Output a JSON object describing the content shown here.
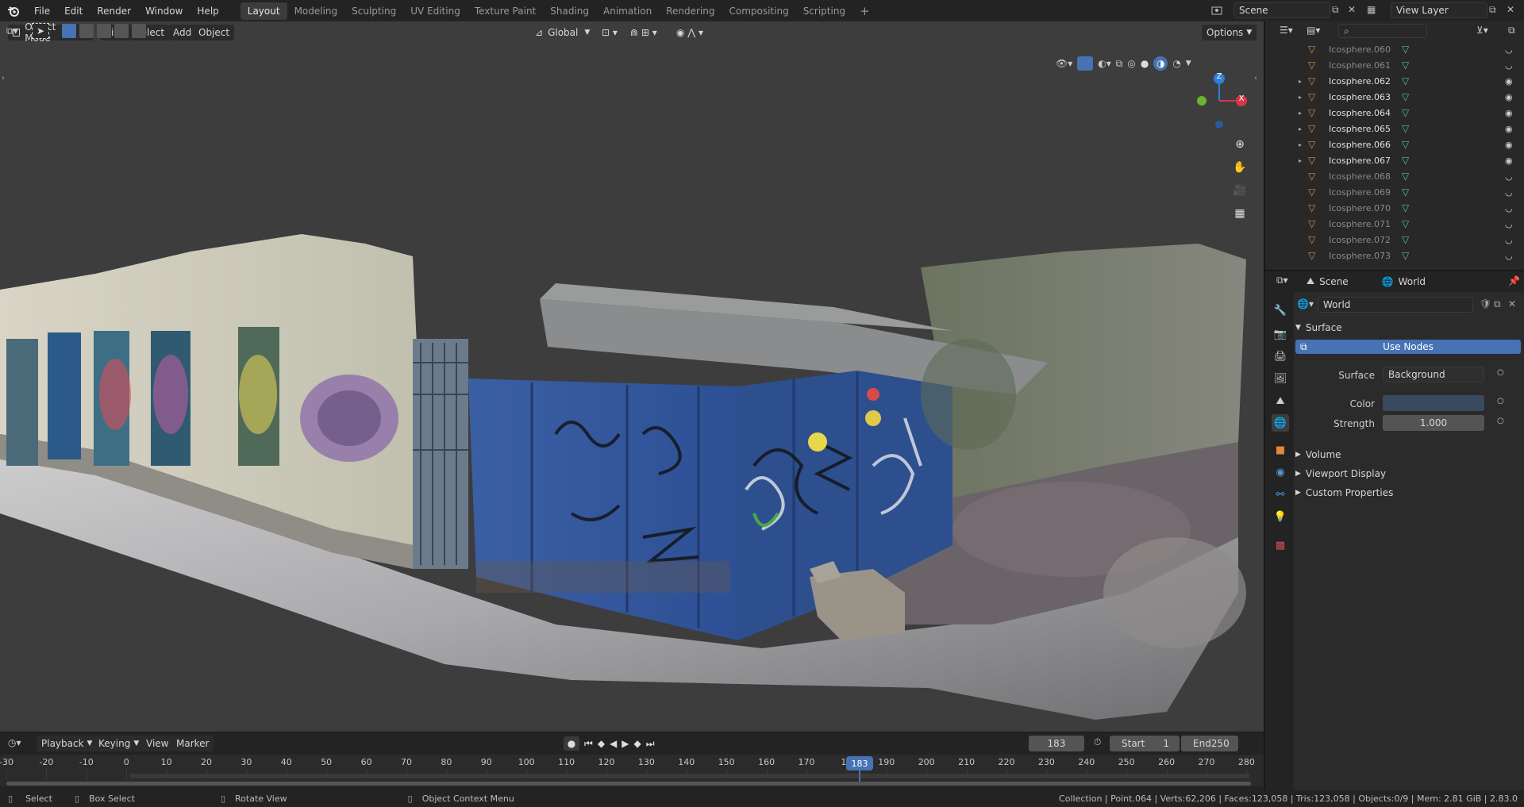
{
  "menus": [
    "File",
    "Edit",
    "Render",
    "Window",
    "Help"
  ],
  "workspaces": [
    "Layout",
    "Modeling",
    "Sculpting",
    "UV Editing",
    "Texture Paint",
    "Shading",
    "Animation",
    "Rendering",
    "Compositing",
    "Scripting"
  ],
  "active_workspace": "Layout",
  "add_workspace_icon": "+",
  "scene_name": "Scene",
  "view_layer_name": "View Layer",
  "viewport": {
    "mode": "Object Mode",
    "header_menus": [
      "View",
      "Select",
      "Add",
      "Object"
    ],
    "transform_orientation": "Global",
    "options_label": "Options",
    "gizmo": {
      "z_label": "Z",
      "x_label": "X",
      "y_label": "Y"
    },
    "nav_icons": [
      "zoom-icon",
      "hand-pan-icon",
      "camera-icon",
      "grid-perspective-icon"
    ]
  },
  "outliner": {
    "search_placeholder": "",
    "items": [
      {
        "name": "Icosphere.060",
        "visible": false
      },
      {
        "name": "Icosphere.061",
        "visible": false
      },
      {
        "name": "Icosphere.062",
        "visible": true
      },
      {
        "name": "Icosphere.063",
        "visible": true
      },
      {
        "name": "Icosphere.064",
        "visible": true
      },
      {
        "name": "Icosphere.065",
        "visible": true
      },
      {
        "name": "Icosphere.066",
        "visible": true
      },
      {
        "name": "Icosphere.067",
        "visible": true
      },
      {
        "name": "Icosphere.068",
        "visible": false
      },
      {
        "name": "Icosphere.069",
        "visible": false
      },
      {
        "name": "Icosphere.070",
        "visible": false
      },
      {
        "name": "Icosphere.071",
        "visible": false
      },
      {
        "name": "Icosphere.072",
        "visible": false
      },
      {
        "name": "Icosphere.073",
        "visible": false
      }
    ]
  },
  "properties": {
    "breadcrumb_scene": "Scene",
    "breadcrumb_world": "World",
    "world_name": "World",
    "surface_panel": "Surface",
    "use_nodes": "Use Nodes",
    "surface_label": "Surface",
    "surface_value": "Background",
    "color_label": "Color",
    "color_value": "#3a4a5e",
    "strength_label": "Strength",
    "strength_value": "1.000",
    "collapsed_panels": [
      "Volume",
      "Viewport Display",
      "Custom Properties"
    ]
  },
  "timeline": {
    "menus": [
      "Playback",
      "Keying",
      "View",
      "Marker"
    ],
    "current_frame": "183",
    "start_label": "Start",
    "start_value": "1",
    "end_label": "End",
    "end_value": "250",
    "ruler": [
      "-30",
      "-20",
      "-10",
      "0",
      "10",
      "20",
      "30",
      "40",
      "50",
      "60",
      "70",
      "80",
      "90",
      "100",
      "110",
      "120",
      "130",
      "140",
      "150",
      "160",
      "170",
      "18",
      "190",
      "200",
      "210",
      "220",
      "230",
      "240",
      "250",
      "260",
      "270",
      "280"
    ],
    "playhead_label": "183"
  },
  "status_bar": {
    "select": "Select",
    "box_select": "Box Select",
    "rotate_view": "Rotate View",
    "context_menu": "Object Context Menu",
    "stats": "Collection | Point.064 | Verts:62,206 | Faces:123,058 | Tris:123,058 | Objects:0/9 | Mem: 2.81 GiB | 2.83.0"
  }
}
